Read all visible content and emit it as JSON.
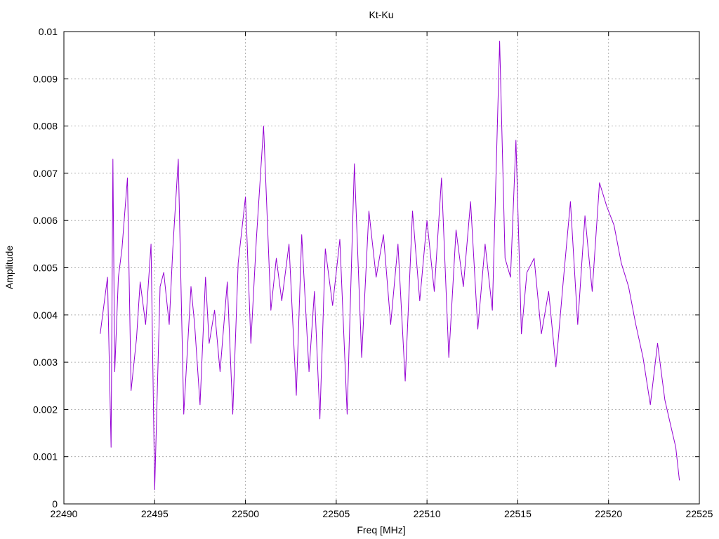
{
  "chart_data": {
    "type": "line",
    "title": "Kt-Ku",
    "xlabel": "Freq [MHz]",
    "ylabel": "Amplitude",
    "xlim": [
      22490,
      22525
    ],
    "ylim": [
      0,
      0.01
    ],
    "x_ticks": [
      22490,
      22495,
      22500,
      22505,
      22510,
      22515,
      22520,
      22525
    ],
    "x_tick_labels": [
      "22490",
      "22495",
      "22500",
      "22505",
      "22510",
      "22515",
      "22520",
      "22525"
    ],
    "y_ticks": [
      0,
      0.001,
      0.002,
      0.003,
      0.004,
      0.005,
      0.006,
      0.007,
      0.008,
      0.009,
      0.01
    ],
    "y_tick_labels": [
      "0",
      "0.001",
      "0.002",
      "0.003",
      "0.004",
      "0.005",
      "0.006",
      "0.007",
      "0.008",
      "0.009",
      "0.01"
    ],
    "grid": true,
    "series": [
      {
        "color": "#9400d3",
        "x": [
          22492.0,
          22492.2,
          22492.4,
          22492.6,
          22492.7,
          22492.8,
          22493.0,
          22493.2,
          22493.5,
          22493.7,
          22494.0,
          22494.2,
          22494.5,
          22494.8,
          22495.0,
          22495.3,
          22495.5,
          22495.8,
          22496.0,
          22496.3,
          22496.6,
          22497.0,
          22497.2,
          22497.5,
          22497.8,
          22498.0,
          22498.3,
          22498.6,
          22499.0,
          22499.3,
          22499.6,
          22500.0,
          22500.3,
          22500.6,
          22501.0,
          22501.4,
          22501.7,
          22502.0,
          22502.4,
          22502.8,
          22503.1,
          22503.5,
          22503.8,
          22504.1,
          22504.4,
          22504.8,
          22505.2,
          22505.6,
          22506.0,
          22506.4,
          22506.8,
          22507.2,
          22507.6,
          22508.0,
          22508.4,
          22508.8,
          22509.2,
          22509.6,
          22510.0,
          22510.4,
          22510.8,
          22511.2,
          22511.6,
          22512.0,
          22512.4,
          22512.8,
          22513.2,
          22513.6,
          22514.0,
          22514.3,
          22514.6,
          22514.9,
          22515.2,
          22515.5,
          22515.9,
          22516.3,
          22516.7,
          22517.1,
          22517.5,
          22517.9,
          22518.3,
          22518.7,
          22519.1,
          22519.5,
          22519.9,
          22520.3,
          22520.7,
          22521.1,
          22521.5,
          22521.9,
          22522.3,
          22522.7,
          22523.1,
          22523.4,
          22523.7,
          22523.9
        ],
        "y": [
          0.0036,
          0.0042,
          0.0048,
          0.0012,
          0.0073,
          0.0028,
          0.0048,
          0.0054,
          0.0069,
          0.0024,
          0.0035,
          0.0047,
          0.0038,
          0.0055,
          0.0003,
          0.0046,
          0.0049,
          0.0038,
          0.0054,
          0.0073,
          0.0019,
          0.0046,
          0.0038,
          0.0021,
          0.0048,
          0.0034,
          0.0041,
          0.0028,
          0.0047,
          0.0019,
          0.0051,
          0.0065,
          0.0034,
          0.0056,
          0.008,
          0.0041,
          0.0052,
          0.0043,
          0.0055,
          0.0023,
          0.0057,
          0.0028,
          0.0045,
          0.0018,
          0.0054,
          0.0042,
          0.0056,
          0.0019,
          0.0072,
          0.0031,
          0.0062,
          0.0048,
          0.0057,
          0.0038,
          0.0055,
          0.0026,
          0.0062,
          0.0043,
          0.006,
          0.0045,
          0.0069,
          0.0031,
          0.0058,
          0.0046,
          0.0064,
          0.0037,
          0.0055,
          0.0041,
          0.0098,
          0.0052,
          0.0048,
          0.0077,
          0.0036,
          0.0049,
          0.0052,
          0.0036,
          0.0045,
          0.0029,
          0.0047,
          0.0064,
          0.0038,
          0.0061,
          0.0045,
          0.0068,
          0.0063,
          0.0059,
          0.0051,
          0.0046,
          0.0038,
          0.0031,
          0.0021,
          0.0034,
          0.0022,
          0.0017,
          0.0012,
          0.0005
        ]
      }
    ]
  }
}
